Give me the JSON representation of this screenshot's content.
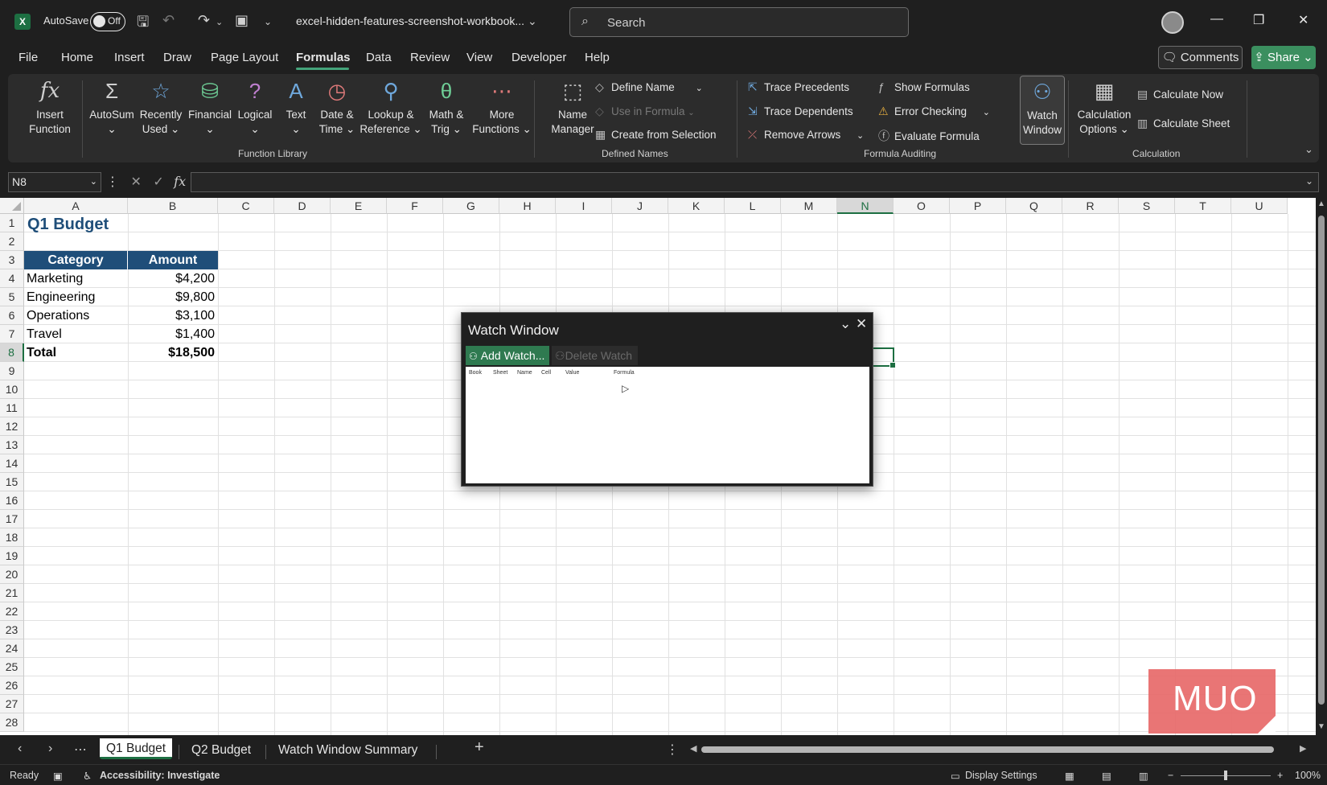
{
  "titlebar": {
    "autosave_label": "AutoSave",
    "autosave_state": "Off",
    "filename": "excel-hidden-features-screenshot-workbook...",
    "search_placeholder": "Search"
  },
  "menu": {
    "items": [
      "File",
      "Home",
      "Insert",
      "Draw",
      "Page Layout",
      "Formulas",
      "Data",
      "Review",
      "View",
      "Developer",
      "Help"
    ],
    "active": "Formulas",
    "comments": "Comments",
    "share": "Share"
  },
  "ribbon": {
    "function_library": {
      "label": "Function Library",
      "buttons": [
        {
          "l1": "Insert",
          "l2": "Function"
        },
        {
          "l1": "AutoSum",
          "l2": "⌄"
        },
        {
          "l1": "Recently",
          "l2": "Used ⌄"
        },
        {
          "l1": "Financial",
          "l2": "⌄"
        },
        {
          "l1": "Logical",
          "l2": "⌄"
        },
        {
          "l1": "Text",
          "l2": "⌄"
        },
        {
          "l1": "Date &",
          "l2": "Time ⌄"
        },
        {
          "l1": "Lookup &",
          "l2": "Reference ⌄"
        },
        {
          "l1": "Math &",
          "l2": "Trig ⌄"
        },
        {
          "l1": "More",
          "l2": "Functions ⌄"
        }
      ]
    },
    "defined_names": {
      "label": "Defined Names",
      "name_manager_l1": "Name",
      "name_manager_l2": "Manager",
      "define_name": "Define Name",
      "use_in_formula": "Use in Formula",
      "create_from_selection": "Create from Selection"
    },
    "formula_auditing": {
      "label": "Formula Auditing",
      "trace_precedents": "Trace Precedents",
      "trace_dependents": "Trace Dependents",
      "remove_arrows": "Remove Arrows",
      "show_formulas": "Show Formulas",
      "error_checking": "Error Checking",
      "evaluate_formula": "Evaluate Formula",
      "watch_window_l1": "Watch",
      "watch_window_l2": "Window"
    },
    "calculation": {
      "label": "Calculation",
      "options_l1": "Calculation",
      "options_l2": "Options ⌄",
      "calculate_now": "Calculate Now",
      "calculate_sheet": "Calculate Sheet"
    }
  },
  "formula_bar": {
    "name_box": "N8",
    "value": ""
  },
  "grid": {
    "columns": [
      "A",
      "B",
      "C",
      "D",
      "E",
      "F",
      "G",
      "H",
      "I",
      "J",
      "K",
      "L",
      "M",
      "N",
      "O",
      "P",
      "Q",
      "R",
      "S",
      "T",
      "U"
    ],
    "selected_column": "N",
    "selected_row": 8,
    "rows": [
      "1",
      "2",
      "3",
      "4",
      "5",
      "6",
      "7",
      "8",
      "9",
      "10",
      "11",
      "12",
      "13",
      "14",
      "15",
      "16",
      "17",
      "18",
      "19",
      "20",
      "21",
      "22",
      "23",
      "24",
      "25",
      "26",
      "27",
      "28"
    ],
    "sheet_title": "Q1 Budget",
    "table_headers": [
      "Category",
      "Amount"
    ],
    "table_rows": [
      {
        "category": "Marketing",
        "amount": "$4,200"
      },
      {
        "category": "Engineering",
        "amount": "$9,800"
      },
      {
        "category": "Operations",
        "amount": "$3,100"
      },
      {
        "category": "Travel",
        "amount": "$1,400"
      }
    ],
    "total_label": "Total",
    "total_amount": "$18,500"
  },
  "watch_window": {
    "title": "Watch Window",
    "add_watch": "Add Watch...",
    "delete_watch": "Delete Watch",
    "columns": [
      "Book",
      "Sheet",
      "Name",
      "Cell",
      "Value",
      "Formula"
    ]
  },
  "sheet_tabs": {
    "tabs": [
      "Q1 Budget",
      "Q2 Budget",
      "Watch Window Summary"
    ],
    "active": "Q1 Budget"
  },
  "status": {
    "ready": "Ready",
    "accessibility": "Accessibility: Investigate",
    "display_settings": "Display Settings",
    "zoom": "100%"
  },
  "watermark": {
    "text": "MUO"
  },
  "colors": {
    "accent_green": "#1d6f42",
    "table_header_blue": "#1f4e79",
    "share_green": "#3b8f5f",
    "watermark_red": "#e86a6a"
  }
}
